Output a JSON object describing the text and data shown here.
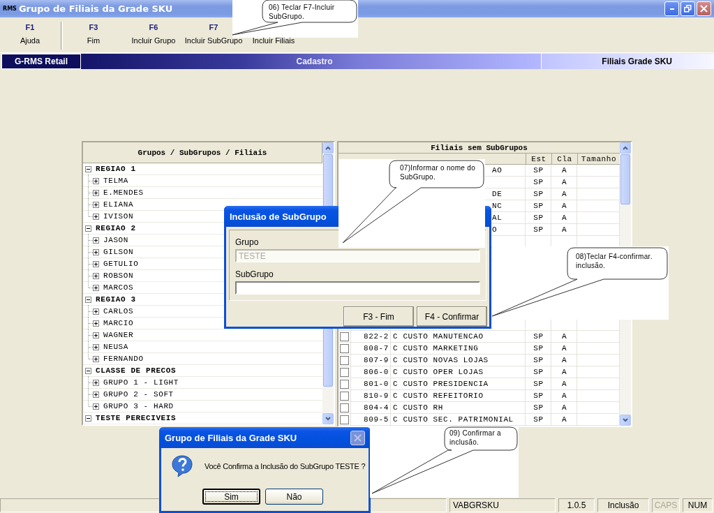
{
  "window": {
    "icon_text": "RMS",
    "title": "Grupo de Filiais da Grade SKU"
  },
  "toolbar": [
    {
      "key": "F1",
      "label": "Ajuda"
    },
    {
      "key": "F3",
      "label": "Fim"
    },
    {
      "key": "F6",
      "label": "Incluir Grupo"
    },
    {
      "key": "F7",
      "label": "Incluir SubGrupo"
    },
    {
      "label": "Incluir Filiais"
    }
  ],
  "banner": {
    "product": "G-RMS Retail",
    "section": "Cadastro",
    "screen": "Filiais Grade SKU"
  },
  "tree_panel": {
    "header": "Grupos / SubGrupos / Filiais",
    "groups": [
      {
        "label": "REGIAO 1",
        "expanded": true,
        "children": [
          {
            "label": "TELMA",
            "expanded": false
          },
          {
            "label": "E.MENDES",
            "expanded": false
          },
          {
            "label": "ELIANA",
            "expanded": false
          },
          {
            "label": "IVISON",
            "expanded": false
          }
        ]
      },
      {
        "label": "REGIAO 2",
        "expanded": true,
        "children": [
          {
            "label": "JASON",
            "expanded": false
          },
          {
            "label": "GILSON",
            "expanded": false
          },
          {
            "label": "GETULIO",
            "expanded": false
          },
          {
            "label": "ROBSON",
            "expanded": false
          },
          {
            "label": "MARCOS",
            "expanded": false
          }
        ]
      },
      {
        "label": "REGIAO 3",
        "expanded": true,
        "children": [
          {
            "label": "CARLOS",
            "expanded": false
          },
          {
            "label": "MARCIO",
            "expanded": false
          },
          {
            "label": "WAGNER",
            "expanded": false
          },
          {
            "label": "NEUSA",
            "expanded": false
          },
          {
            "label": "FERNANDO",
            "expanded": false
          }
        ]
      },
      {
        "label": "CLASSE DE PRECOS",
        "expanded": true,
        "children": [
          {
            "label": "GRUPO 1 - LIGHT",
            "expanded": false
          },
          {
            "label": "GRUPO 2 - SOFT",
            "expanded": false
          },
          {
            "label": "GRUPO 3 - HARD",
            "expanded": false
          }
        ]
      },
      {
        "label": "TESTE PERECIVEIS",
        "expanded": true
      }
    ]
  },
  "table_panel": {
    "title": "Filiais sem SubGrupos",
    "columns": [
      "Est",
      "Cla",
      "Tamanho"
    ],
    "rows": [
      {
        "kind": "partial",
        "description": "AO",
        "est": "SP",
        "cla": "A"
      },
      {
        "kind": "partial",
        "est": "SP",
        "cla": "A"
      },
      {
        "kind": "partial",
        "description": "DE",
        "est": "SP",
        "cla": "A"
      },
      {
        "kind": "partial",
        "description": "NC",
        "est": "SP",
        "cla": "A"
      },
      {
        "kind": "partial",
        "description": "AL",
        "est": "SP",
        "cla": "A"
      },
      {
        "kind": "partial",
        "description": "O",
        "est": "SP",
        "cla": "A"
      },
      {
        "kind": "full",
        "checked": false,
        "code": "822-2",
        "description": "C CUSTO MANUTENCAO",
        "est": "SP",
        "cla": "A"
      },
      {
        "kind": "full",
        "checked": false,
        "code": "808-7",
        "description": "C CUSTO MARKETING",
        "est": "SP",
        "cla": "A"
      },
      {
        "kind": "full",
        "checked": false,
        "code": "807-9",
        "description": "C CUSTO NOVAS LOJAS",
        "est": "SP",
        "cla": "A"
      },
      {
        "kind": "full",
        "checked": false,
        "code": "806-0",
        "description": "C CUSTO OPER LOJAS",
        "est": "SP",
        "cla": "A"
      },
      {
        "kind": "full",
        "checked": false,
        "code": "801-0",
        "description": "C CUSTO PRESIDENCIA",
        "est": "SP",
        "cla": "A"
      },
      {
        "kind": "full",
        "checked": false,
        "code": "810-9",
        "description": "C CUSTO REFEITORIO",
        "est": "SP",
        "cla": "A"
      },
      {
        "kind": "full",
        "checked": false,
        "code": "804-4",
        "description": "C CUSTO RH",
        "est": "SP",
        "cla": "A"
      },
      {
        "kind": "full",
        "checked": false,
        "code": "809-5",
        "description": "C CUSTO SEC. PATRIMONIAL",
        "est": "SP",
        "cla": "A"
      }
    ]
  },
  "subgroup_dialog": {
    "title": "Inclusão de SubGrupo",
    "fields": [
      {
        "label": "Grupo",
        "value": "TESTE",
        "disabled": true
      },
      {
        "label": "SubGrupo",
        "disabled": false
      }
    ],
    "buttons": [
      "F3 - Fim",
      "F4 - Confirmar"
    ]
  },
  "confirm_dialog": {
    "title": "Grupo de Filiais da Grade SKU",
    "message": "Você Confirma a Inclusão do SubGrupo TESTE ?",
    "buttons": [
      {
        "label": "Sim",
        "default": true
      },
      {
        "label": "Não",
        "default": false
      }
    ]
  },
  "callouts": [
    {
      "text": "06) Teclar F7-Incluir\nSubGrupo."
    },
    {
      "text": "07)Informar o nome do\nSubGrupo."
    },
    {
      "text": "08)Teclar F4-confirmar.\ninclusão."
    },
    {
      "text": "09) Confirmar a\ninclusão."
    }
  ],
  "status_bar": [
    {
      "text": "VABGRSKU",
      "disabled": false
    },
    {
      "text": "1.0.5",
      "disabled": false
    },
    {
      "text": "Inclusão",
      "disabled": false
    },
    {
      "text": "CAPS",
      "disabled": true
    },
    {
      "text": "NUM",
      "disabled": false
    }
  ]
}
